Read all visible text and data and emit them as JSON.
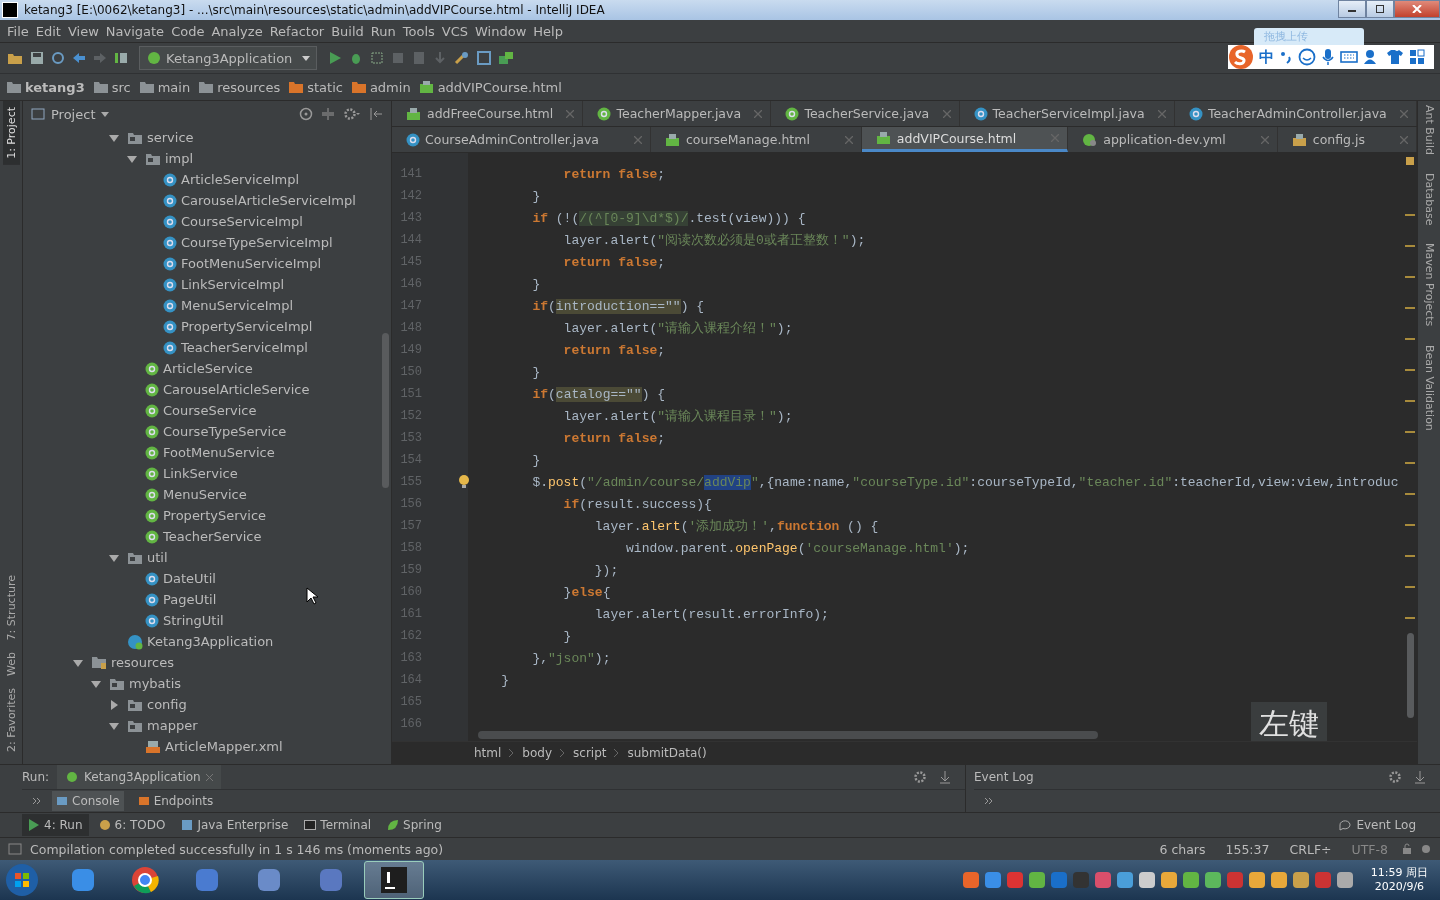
{
  "window": {
    "title": "ketang3 [E:\\0062\\ketang3] - ...\\src\\main\\resources\\static\\admin\\addVIPCourse.html - IntelliJ IDEA"
  },
  "menu": [
    "File",
    "Edit",
    "View",
    "Navigate",
    "Code",
    "Analyze",
    "Refactor",
    "Build",
    "Run",
    "Tools",
    "VCS",
    "Window",
    "Help"
  ],
  "toolbar": {
    "run_config": "Ketang3Application"
  },
  "ime_bar": {
    "upload_hint": "拖拽上传",
    "mode": "中"
  },
  "nav_bar": [
    {
      "label": "ketang3",
      "kind": "project"
    },
    {
      "label": "src",
      "kind": "folder"
    },
    {
      "label": "main",
      "kind": "folder"
    },
    {
      "label": "resources",
      "kind": "resources"
    },
    {
      "label": "static",
      "kind": "web"
    },
    {
      "label": "admin",
      "kind": "web"
    },
    {
      "label": "addVIPCourse.html",
      "kind": "html"
    }
  ],
  "left_stripe": [
    {
      "label": "1: Project",
      "selected": true
    },
    {
      "label": "7: Structure",
      "selected": false
    },
    {
      "label": "Web",
      "selected": false
    },
    {
      "label": "2: Favorites",
      "selected": false
    }
  ],
  "right_stripe": [
    "Ant Build",
    "Database",
    "Maven Projects",
    "Bean Validation"
  ],
  "project": {
    "title": "Project",
    "tree": [
      {
        "children": [
          {
            "children": [
              {
                "label": "service",
                "kind": "folder",
                "expanded": true,
                "children": [
                  {
                    "label": "impl",
                    "kind": "folder",
                    "expanded": true,
                    "children": [
                      {
                        "label": "ArticleServiceImpl",
                        "kind": "class"
                      },
                      {
                        "label": "CarouselArticleServiceImpl",
                        "kind": "class"
                      },
                      {
                        "label": "CourseServiceImpl",
                        "kind": "class"
                      },
                      {
                        "label": "CourseTypeServiceImpl",
                        "kind": "class"
                      },
                      {
                        "label": "FootMenuServiceImpl",
                        "kind": "class"
                      },
                      {
                        "label": "LinkServiceImpl",
                        "kind": "class"
                      },
                      {
                        "label": "MenuServiceImpl",
                        "kind": "class"
                      },
                      {
                        "label": "PropertyServiceImpl",
                        "kind": "class"
                      },
                      {
                        "label": "TeacherServiceImpl",
                        "kind": "class"
                      }
                    ]
                  },
                  {
                    "label": "ArticleService",
                    "kind": "interface"
                  },
                  {
                    "label": "CarouselArticleService",
                    "kind": "interface"
                  },
                  {
                    "label": "CourseService",
                    "kind": "interface"
                  },
                  {
                    "label": "CourseTypeService",
                    "kind": "interface"
                  },
                  {
                    "label": "FootMenuService",
                    "kind": "interface"
                  },
                  {
                    "label": "LinkService",
                    "kind": "interface"
                  },
                  {
                    "label": "MenuService",
                    "kind": "interface"
                  },
                  {
                    "label": "PropertyService",
                    "kind": "interface"
                  },
                  {
                    "label": "TeacherService",
                    "kind": "interface"
                  }
                ]
              },
              {
                "label": "util",
                "kind": "folder",
                "expanded": true,
                "children": [
                  {
                    "label": "DateUtil",
                    "kind": "class"
                  },
                  {
                    "label": "PageUtil",
                    "kind": "class"
                  },
                  {
                    "label": "StringUtil",
                    "kind": "class"
                  }
                ]
              },
              {
                "label": "Ketang3Application",
                "kind": "app"
              }
            ]
          }
        ]
      },
      {
        "label": "resources",
        "kind": "resources",
        "expanded": true,
        "children": [
          {
            "label": "mybatis",
            "kind": "folder",
            "expanded": true,
            "children": [
              {
                "label": "config",
                "kind": "folder",
                "expanded": false
              },
              {
                "label": "mapper",
                "kind": "folder",
                "expanded": true,
                "children": [
                  {
                    "label": "ArticleMapper.xml",
                    "kind": "xml"
                  }
                ]
              }
            ]
          }
        ]
      }
    ]
  },
  "editor": {
    "tab_rows": [
      {
        "tabs": [
          {
            "label": "addFreeCourse.html",
            "kind": "html",
            "selected": false
          },
          {
            "label": "TeacherMapper.java",
            "kind": "interface",
            "selected": false
          },
          {
            "label": "TeacherService.java",
            "kind": "interface",
            "selected": false
          },
          {
            "label": "TeacherServiceImpl.java",
            "kind": "class",
            "selected": false
          },
          {
            "label": "TeacherAdminController.java",
            "kind": "class",
            "selected": false
          }
        ]
      },
      {
        "tabs": [
          {
            "label": "CourseAdminController.java",
            "kind": "class",
            "selected": false
          },
          {
            "label": "courseManage.html",
            "kind": "html",
            "selected": false
          },
          {
            "label": "addVIPCourse.html",
            "kind": "html",
            "selected": true
          },
          {
            "label": "application-dev.yml",
            "kind": "yml",
            "selected": false
          },
          {
            "label": "config.js",
            "kind": "js",
            "selected": false
          }
        ]
      }
    ],
    "lines": [
      {
        "no": "141",
        "tokens": [
          {
            "text": "            return false",
            "kind": "kw"
          },
          {
            "text": ";"
          }
        ]
      },
      {
        "no": "142",
        "tokens": [
          {
            "text": "        }"
          }
        ]
      },
      {
        "no": "143",
        "tokens": [
          {
            "text": "        if",
            "kind": "kw"
          },
          {
            "text": " (!("
          },
          {
            "text": "/(^[0-9]\\d*$)/",
            "kind": "re"
          },
          {
            "text": ".test(view))) {"
          }
        ]
      },
      {
        "no": "144",
        "tokens": [
          {
            "text": "            layer.alert("
          },
          {
            "text": "\"阅读次数必须是0或者正整数！\"",
            "kind": "str"
          },
          {
            "text": ");"
          }
        ]
      },
      {
        "no": "145",
        "tokens": [
          {
            "text": "            return false",
            "kind": "kw"
          },
          {
            "text": ";"
          }
        ]
      },
      {
        "no": "146",
        "tokens": [
          {
            "text": "        }"
          }
        ]
      },
      {
        "no": "147",
        "tokens": [
          {
            "text": "        if",
            "kind": "kw"
          },
          {
            "text": "("
          },
          {
            "text": "introduction==\"\"",
            "kind": "hl"
          },
          {
            "text": ") {"
          }
        ]
      },
      {
        "no": "148",
        "tokens": [
          {
            "text": "            layer.alert("
          },
          {
            "text": "\"请输入课程介绍！\"",
            "kind": "str"
          },
          {
            "text": ");"
          }
        ]
      },
      {
        "no": "149",
        "tokens": [
          {
            "text": "            return false",
            "kind": "kw"
          },
          {
            "text": ";"
          }
        ]
      },
      {
        "no": "150",
        "tokens": [
          {
            "text": "        }"
          }
        ]
      },
      {
        "no": "151",
        "tokens": [
          {
            "text": "        if",
            "kind": "kw"
          },
          {
            "text": "("
          },
          {
            "text": "catalog==\"\"",
            "kind": "hl"
          },
          {
            "text": ") {"
          }
        ]
      },
      {
        "no": "152",
        "tokens": [
          {
            "text": "            layer.alert("
          },
          {
            "text": "\"请输入课程目录！\"",
            "kind": "str"
          },
          {
            "text": ");"
          }
        ]
      },
      {
        "no": "153",
        "tokens": [
          {
            "text": "            return false",
            "kind": "kw"
          },
          {
            "text": ";"
          }
        ]
      },
      {
        "no": "154",
        "tokens": [
          {
            "text": "        }"
          }
        ]
      },
      {
        "no": "155",
        "tokens": [
          {
            "text": "        $."
          },
          {
            "text": "post",
            "kind": "fn"
          },
          {
            "text": "("
          },
          {
            "text": "\"/admin/course/",
            "kind": "str"
          },
          {
            "text": "addVip",
            "kind": "sel"
          },
          {
            "text": "\"",
            "kind": "str"
          },
          {
            "text": ",{name:name,"
          },
          {
            "text": "\"courseType.id\"",
            "kind": "str"
          },
          {
            "text": ":courseTypeId,"
          },
          {
            "text": "\"teacher.id\"",
            "kind": "str"
          },
          {
            "text": ":teacherId,view:view,introduc"
          }
        ]
      },
      {
        "no": "156",
        "tokens": [
          {
            "text": "            if",
            "kind": "kw"
          },
          {
            "text": "(result.success){"
          }
        ]
      },
      {
        "no": "157",
        "tokens": [
          {
            "text": "                layer."
          },
          {
            "text": "alert",
            "kind": "fn"
          },
          {
            "text": "("
          },
          {
            "text": "'添加成功！'",
            "kind": "str"
          },
          {
            "text": ","
          },
          {
            "text": "function",
            "kind": "kw"
          },
          {
            "text": " () {"
          }
        ]
      },
      {
        "no": "158",
        "tokens": [
          {
            "text": "                    window.parent."
          },
          {
            "text": "openPage",
            "kind": "fn"
          },
          {
            "text": "("
          },
          {
            "text": "'courseManage.html'",
            "kind": "str"
          },
          {
            "text": ");"
          }
        ]
      },
      {
        "no": "159",
        "tokens": [
          {
            "text": "                });"
          }
        ]
      },
      {
        "no": "160",
        "tokens": [
          {
            "text": "            }"
          },
          {
            "text": "else",
            "kind": "kw"
          },
          {
            "text": "{"
          }
        ]
      },
      {
        "no": "161",
        "tokens": [
          {
            "text": "                layer.alert(result.errorInfo);"
          }
        ]
      },
      {
        "no": "162",
        "tokens": [
          {
            "text": "            }"
          }
        ]
      },
      {
        "no": "163",
        "tokens": [
          {
            "text": "        },"
          },
          {
            "text": "\"json\"",
            "kind": "str"
          },
          {
            "text": ");"
          }
        ]
      },
      {
        "no": "164",
        "tokens": [
          {
            "text": "    }"
          }
        ]
      },
      {
        "no": "165"
      },
      {
        "no": "166"
      }
    ],
    "breadcrumb": [
      "html",
      "body",
      "script",
      "submitData()"
    ],
    "key_overlay": "左键"
  },
  "run_panel": {
    "label": "Run:",
    "tab": "Ketang3Application",
    "subtabs": [
      {
        "label": "Console",
        "selected": true
      },
      {
        "label": "Endpoints",
        "selected": false
      }
    ],
    "event_log_title": "Event Log"
  },
  "tool_buttons": [
    {
      "label": "4: Run",
      "kind": "run",
      "selected": true
    },
    {
      "label": "6: TODO",
      "kind": "todo",
      "selected": false
    },
    {
      "label": "Java Enterprise",
      "kind": "enterprise",
      "selected": false
    },
    {
      "label": "Terminal",
      "kind": "terminal",
      "selected": false
    },
    {
      "label": "Spring",
      "kind": "spring",
      "selected": false
    }
  ],
  "event_log_button": "Event Log",
  "status_bar": {
    "message": "Compilation completed successfully in 1 s 146 ms (moments ago)",
    "selection": "6 chars",
    "position": "155:37",
    "line_sep": "CRLF÷",
    "encoding": "UTF-8"
  },
  "taskbar": {
    "apps": [
      {
        "kind": "app",
        "selected": false
      },
      {
        "kind": "browser",
        "selected": false
      },
      {
        "kind": "app",
        "selected": false
      },
      {
        "kind": "app",
        "selected": false
      },
      {
        "kind": "app",
        "selected": false
      },
      {
        "kind": "ide",
        "selected": true
      }
    ],
    "time": "11:59 周日",
    "date": "2020/9/6"
  }
}
